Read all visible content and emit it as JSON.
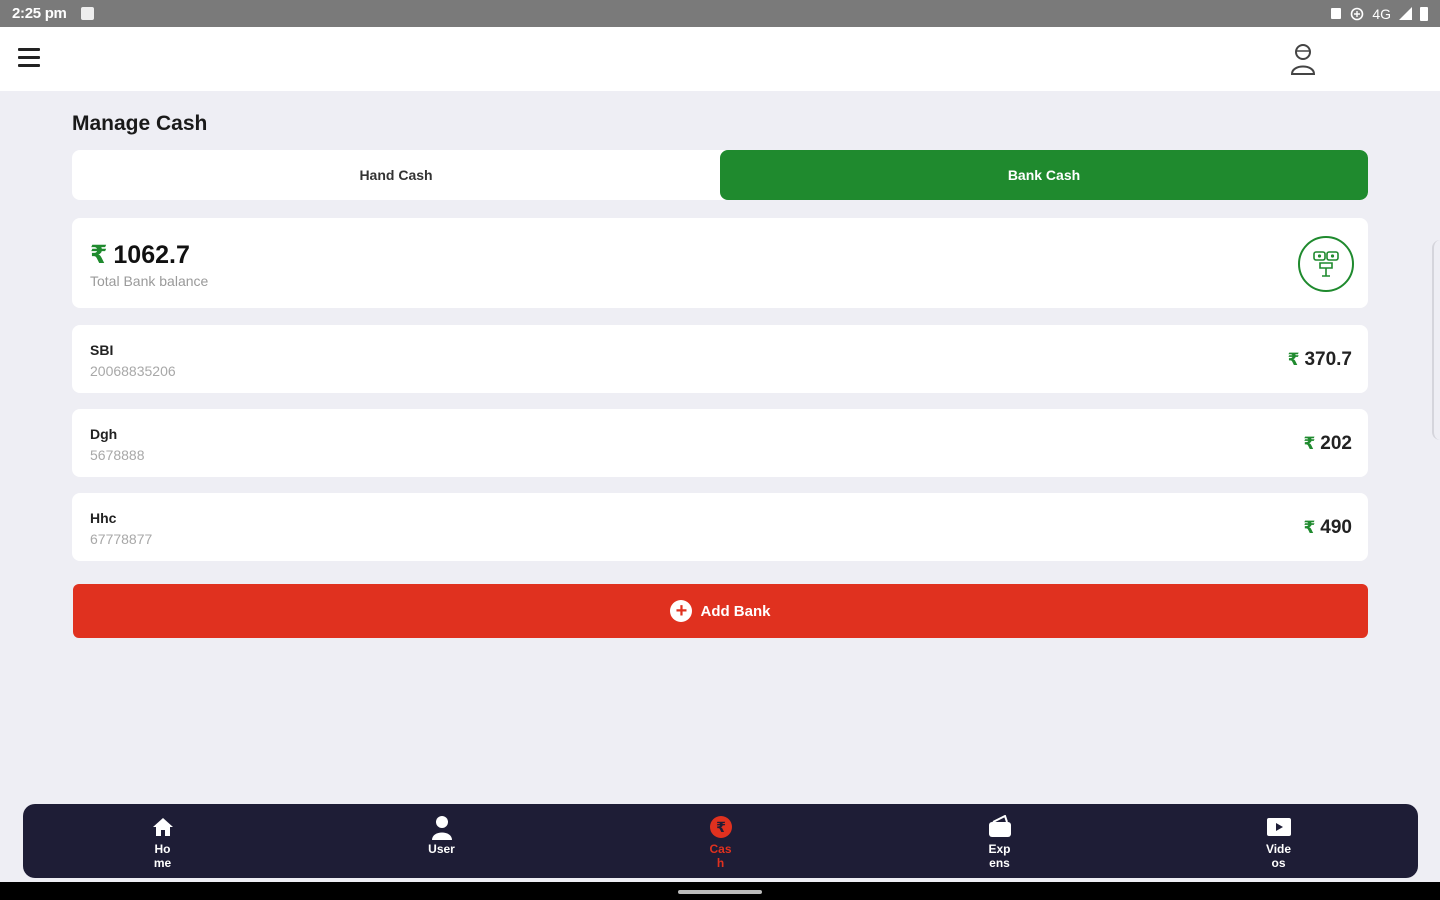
{
  "status_bar": {
    "time": "2:25 pm",
    "right_text": "4G"
  },
  "appbar": {
    "menu_icon": "hamburger-menu-icon",
    "profile_icon": "user-profile-icon"
  },
  "page": {
    "title": "Manage Cash"
  },
  "tabs": [
    {
      "label": "Hand Cash",
      "active": false
    },
    {
      "label": "Bank Cash",
      "active": true
    }
  ],
  "currency_symbol": "₹",
  "total": {
    "amount": "1062.7",
    "label": "Total Bank balance",
    "icon": "money-icon"
  },
  "banks": [
    {
      "name": "SBI",
      "account": "20068835206",
      "amount": "370.7"
    },
    {
      "name": "Dgh",
      "account": "5678888",
      "amount": "202"
    },
    {
      "name": "Hhc",
      "account": "67778877",
      "amount": "490"
    }
  ],
  "add_bank": {
    "label": "Add Bank"
  },
  "bottom_nav": [
    {
      "label": "Ho me",
      "icon": "home-icon",
      "active": false
    },
    {
      "label": "User",
      "icon": "user-icon",
      "active": false
    },
    {
      "label": "Cas h",
      "icon": "cash-icon",
      "active": true
    },
    {
      "label": "Exp ens es",
      "icon": "wallet-icon",
      "active": false
    },
    {
      "label": "Vide os",
      "icon": "video-icon",
      "active": false
    }
  ],
  "colors": {
    "accent_green": "#1f8a2e",
    "accent_red": "#e0311f",
    "nav_background": "#1e1d36",
    "page_background": "#eeeef4"
  }
}
